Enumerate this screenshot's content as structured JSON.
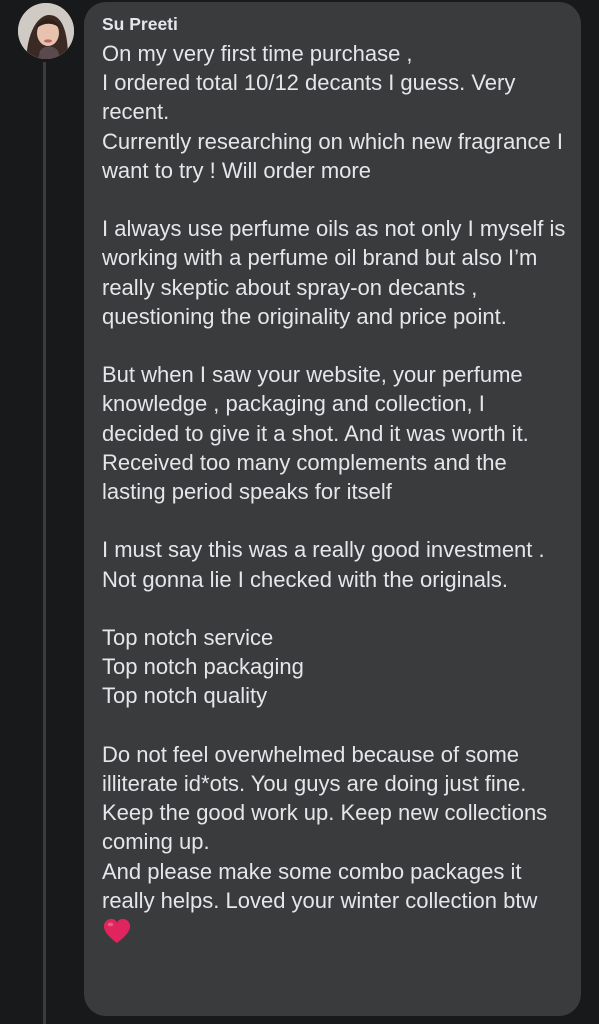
{
  "comment": {
    "author": "Su Preeti",
    "avatar_icon": "profile-photo-avatar",
    "text": "On my very first time purchase ,\nI ordered total 10/12 decants I guess. Very recent.\nCurrently researching on which new fragrance I want to try ! Will order more\n\nI always use perfume oils as not only I myself is working with a perfume oil brand but also I’m really skeptic about spray-on decants , questioning the originality and price point.\n\nBut when I saw your website, your perfume knowledge , packaging and collection, I decided to give it a shot. And it was worth it. Received too many complements and the lasting period speaks for itself\n\nI must say this was a really good investment . Not gonna lie I checked with the originals.\n\nTop notch service\nTop notch packaging\nTop notch quality\n\nDo not feel overwhelmed because of some illiterate id*ots. You guys are doing just fine. Keep the good work up. Keep new collections coming up.\nAnd please make some combo packages it really helps. Loved your winter collection btw",
    "emoji_icon": "red-heart-icon"
  },
  "colors": {
    "background": "#18191a",
    "bubble": "#3a3b3c",
    "text": "#e4e6eb",
    "heart": "#e0245e"
  }
}
